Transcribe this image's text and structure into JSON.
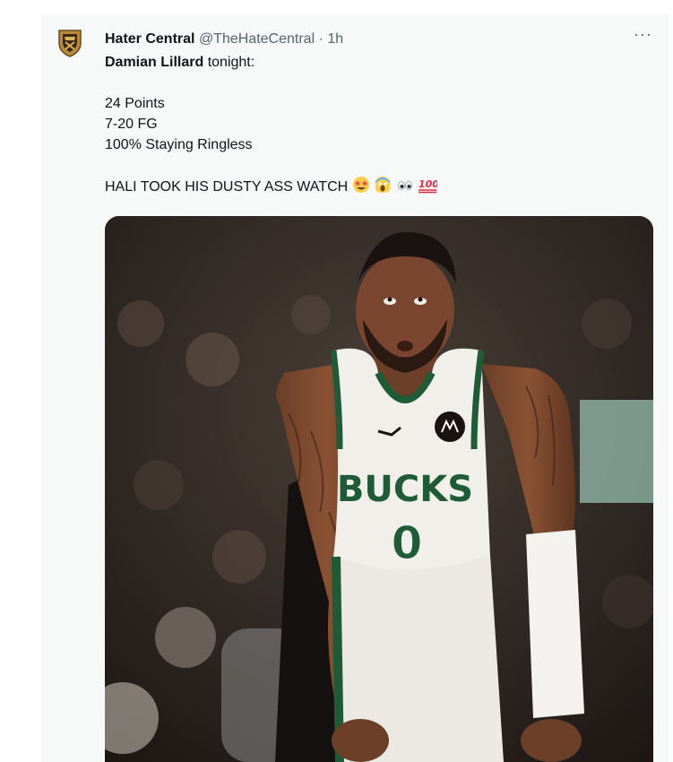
{
  "tweet": {
    "display_name": "Hater Central",
    "handle": "@TheHateCentral",
    "separator": "·",
    "timestamp": "1h",
    "more_label": "···",
    "lead_bold": "Damian Lillard",
    "lead_rest": " tonight:",
    "stats": [
      "24 Points",
      "7-20 FG",
      "100% Staying Ringless"
    ],
    "closing": "HALI TOOK HIS DUSTY ASS WATCH",
    "emoji_names": [
      "star-struck-emoji",
      "screaming-face-emoji",
      "eyes-emoji",
      "hundred-points-emoji"
    ],
    "emoji_hundred": "100",
    "media": {
      "jersey_text": "BUCKS",
      "jersey_number": "0",
      "colors": {
        "bucks_green": "#1f5b36",
        "jersey_white": "#f1efea"
      }
    }
  }
}
